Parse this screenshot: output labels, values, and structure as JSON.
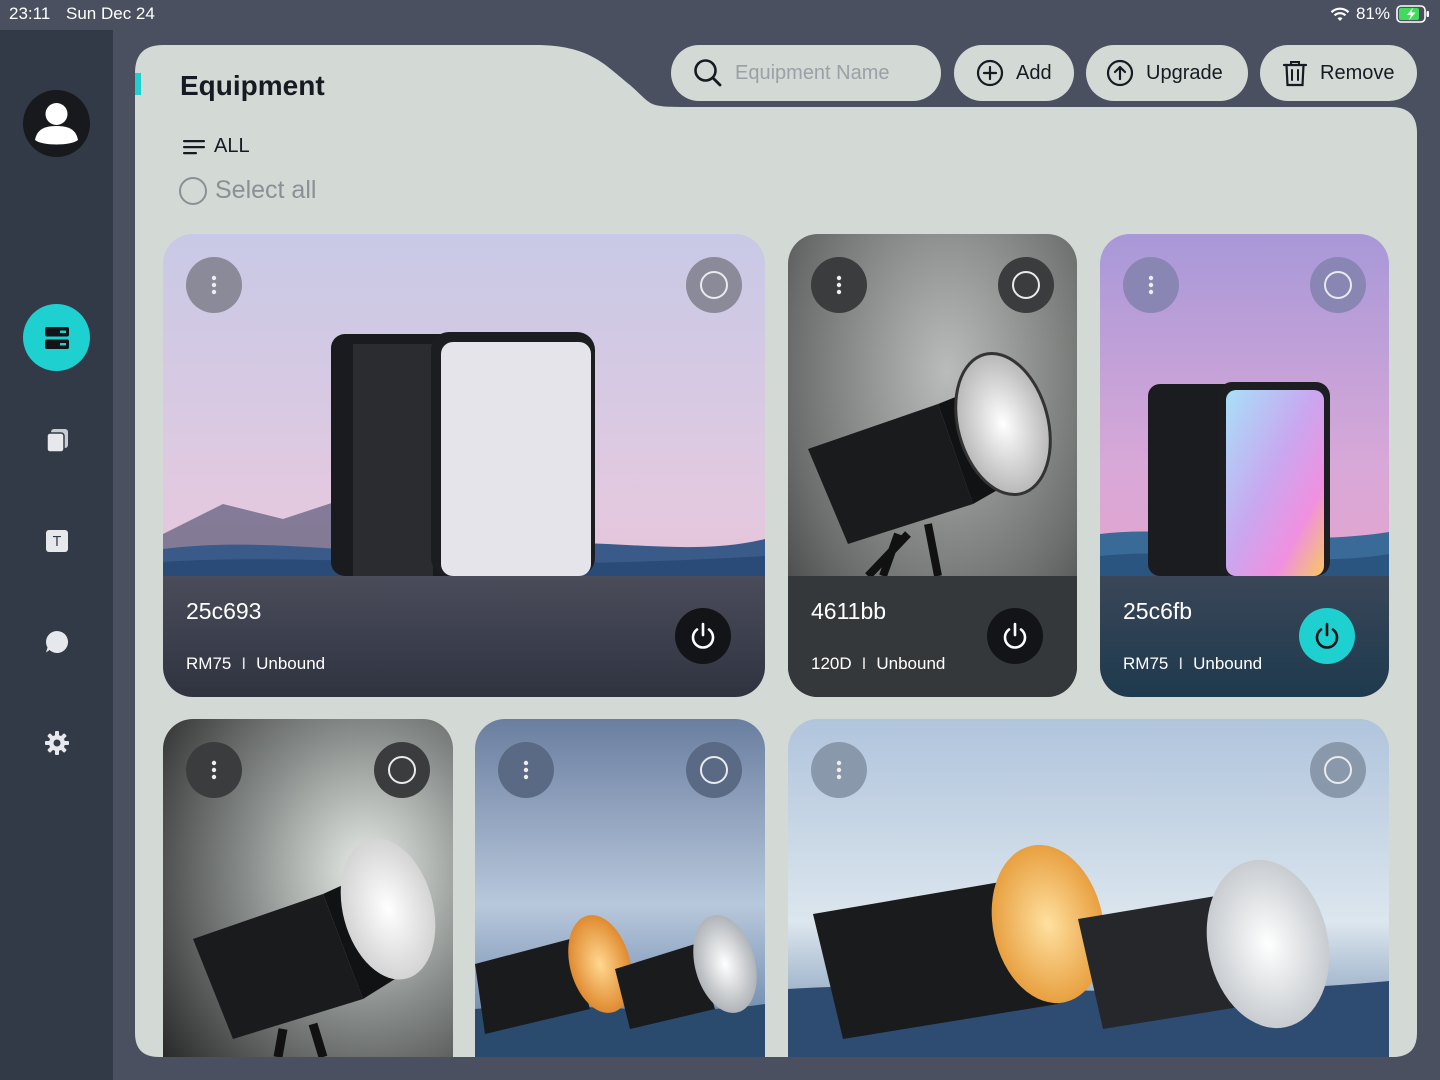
{
  "status_bar": {
    "time": "23:11",
    "date": "Sun Dec 24",
    "battery": "81%"
  },
  "page": {
    "title": "Equipment",
    "filter_label": "ALL",
    "select_all_label": "Select all"
  },
  "toolbar": {
    "search_placeholder": "Equipment Name",
    "add_label": "Add",
    "upgrade_label": "Upgrade",
    "remove_label": "Remove"
  },
  "sidebar": {
    "items": [
      {
        "icon": "devices-icon",
        "active": true
      },
      {
        "icon": "library-icon",
        "active": false
      },
      {
        "icon": "text-icon",
        "active": false
      },
      {
        "icon": "chat-icon",
        "active": false
      },
      {
        "icon": "gear-icon",
        "active": false
      }
    ]
  },
  "cards": [
    {
      "name": "25c693",
      "model": "RM75",
      "separator": "I",
      "status": "Unbound",
      "power_on": false
    },
    {
      "name": "4611bb",
      "model": "120D",
      "separator": "I",
      "status": "Unbound",
      "power_on": false
    },
    {
      "name": "25c6fb",
      "model": "RM75",
      "separator": "I",
      "status": "Unbound",
      "power_on": true
    },
    {},
    {},
    {}
  ],
  "colors": {
    "accent": "#1fd0d0",
    "sidebar": "#323a47",
    "panel": "#d3d9d4",
    "background": "#4a5060"
  }
}
